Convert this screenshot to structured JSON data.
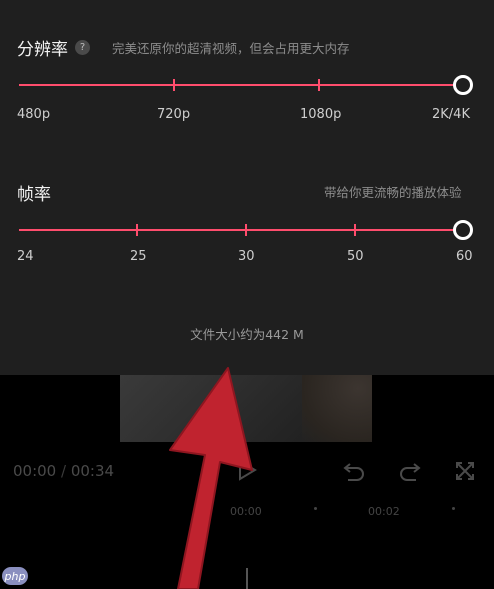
{
  "resolution": {
    "label": "分辨率",
    "help_icon": "?",
    "hint": "完美还原你的超清视频，但会占用更大内存",
    "options": [
      "480p",
      "720p",
      "1080p",
      "2K/4K"
    ],
    "selected": "2K/4K"
  },
  "frame_rate": {
    "label": "帧率",
    "hint": "带给你更流畅的播放体验",
    "options": [
      "24",
      "25",
      "30",
      "50",
      "60"
    ],
    "selected": "60"
  },
  "file_size": "文件大小约为442 M",
  "player": {
    "current_time": "00:00",
    "separator": " / ",
    "total_time": "00:34",
    "icons": [
      "play-icon",
      "undo-icon",
      "redo-icon",
      "fullscreen-icon"
    ]
  },
  "timeline": {
    "marks": [
      "00:00",
      "00:02"
    ]
  },
  "colors": {
    "accent": "#ff4d6d",
    "sheet_bg": "#1f1f1f",
    "annotation_arrow": "#c0232f"
  },
  "watermark": "php"
}
